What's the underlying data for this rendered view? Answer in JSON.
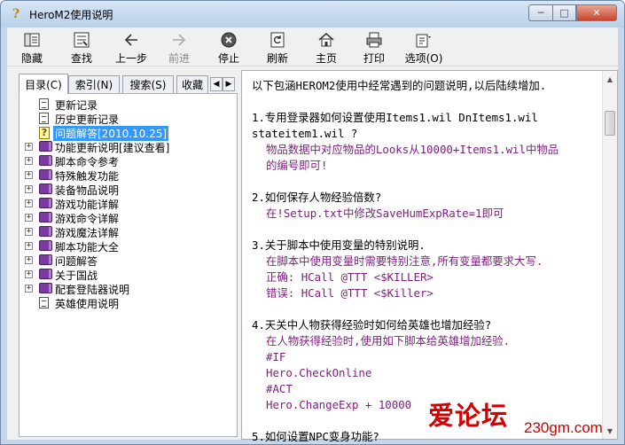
{
  "window": {
    "title": "HeroM2使用说明"
  },
  "toolbar": [
    {
      "label": "隐藏",
      "icon": "hide-icon"
    },
    {
      "label": "查找",
      "icon": "locate-icon"
    },
    {
      "label": "上一步",
      "icon": "back-arrow-icon"
    },
    {
      "label": "前进",
      "icon": "forward-arrow-icon",
      "disabled": true
    },
    {
      "label": "停止",
      "icon": "stop-icon"
    },
    {
      "label": "刷新",
      "icon": "refresh-icon"
    },
    {
      "label": "主页",
      "icon": "home-icon"
    },
    {
      "label": "打印",
      "icon": "print-icon"
    },
    {
      "label": "选项(O)",
      "icon": "options-icon"
    }
  ],
  "tabs": [
    "目录(C)",
    "索引(N)",
    "搜索(S)",
    "收藏"
  ],
  "tree": [
    {
      "label": "更新记录",
      "type": "page"
    },
    {
      "label": "历史更新记录",
      "type": "page"
    },
    {
      "label": "问题解答[2010.10.25]",
      "type": "help-page",
      "selected": true
    },
    {
      "label": "功能更新说明[建议查看]",
      "type": "book"
    },
    {
      "label": "脚本命令参考",
      "type": "book"
    },
    {
      "label": "特殊触发功能",
      "type": "book"
    },
    {
      "label": "装备物品说明",
      "type": "book"
    },
    {
      "label": "游戏功能详解",
      "type": "book"
    },
    {
      "label": "游戏命令详解",
      "type": "book"
    },
    {
      "label": "游戏魔法详解",
      "type": "book"
    },
    {
      "label": "脚本功能大全",
      "type": "book"
    },
    {
      "label": "问题解答",
      "type": "book"
    },
    {
      "label": "关于国战",
      "type": "book"
    },
    {
      "label": "配套登陆器说明",
      "type": "book"
    },
    {
      "label": "英雄使用说明",
      "type": "page"
    }
  ],
  "content": {
    "intro": "以下包涵HEROM2使用中经常遇到的问题说明,以后陆续增加.",
    "q1_line1": "1.专用登录器如何设置使用Items1.wil DnItems1.wil",
    "q1_line2": "stateitem1.wil ?",
    "a1_line1": "物品数据中对应物品的Looks从10000+Items1.wil中物品",
    "a1_line2": "的编号即可!",
    "q2": "2.如何保存人物经验倍数?",
    "a2": "在!Setup.txt中修改SaveHumExpRate=1即可",
    "q3": "3.关于脚本中使用变量的特别说明.",
    "a3_line1": "在脚本中使用变量时需要特别注意,所有变量都要求大写.",
    "a3_line2": "正确: HCall @TTT <$KILLER>",
    "a3_line3": "错误: HCall @TTT <$Killer>",
    "q4": "4.天关中人物获得经验时如何给英雄也增加经验?",
    "a4_line1": "在人物获得经验时,使用如下脚本给英雄增加经验.",
    "a4_line2": "#IF",
    "a4_line3": "Hero.CheckOnline",
    "a4_line4": "#ACT",
    "a4_line5": "Hero.ChangeExp + 10000",
    "q5_partial": "5.如何设置NPC变身功能?"
  },
  "watermark": {
    "main": "爱论坛",
    "sub": "230gm.com"
  },
  "colors": {
    "answer": "#7a1f7a",
    "selection": "#3399ff",
    "watermark": "#d40000"
  }
}
